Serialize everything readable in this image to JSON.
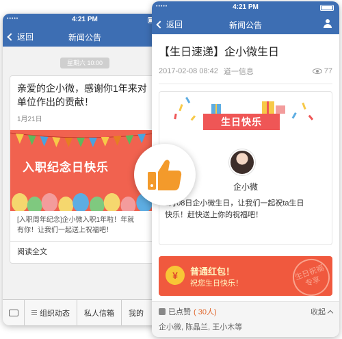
{
  "status_bar": {
    "carrier": "•••••",
    "time": "4:21 PM"
  },
  "left_screen": {
    "nav": {
      "back_label": "返回",
      "title": "新闻公告"
    },
    "timestamp": "星期六 10:00",
    "message": {
      "title": "亲爱的企小微，感谢你1年来对\n单位作出的贡献！",
      "date": "1月21日",
      "banner_text": "入职纪念日快乐",
      "summary": "[入职周年纪念]企小微入职1年啦！年就\n有你！让我们一起送上祝福吧！",
      "read_more": "阅读全文"
    },
    "bottom_tabs": [
      {
        "label": "组织动态"
      },
      {
        "label": "私人信箱"
      },
      {
        "label": "我的"
      }
    ]
  },
  "right_screen": {
    "nav": {
      "back_label": "返回",
      "title": "新闻公告"
    },
    "article": {
      "title": "【生日速递】企小微生日",
      "date": "2017-02-08 08:42",
      "source": "道一信息",
      "views": "77"
    },
    "birthday_card": {
      "ribbon_text": "生日快乐",
      "name": "企小微",
      "text": "2月08日企小微生日，让我们一起祝ta生日\n快乐！赶快送上你的祝福吧！"
    },
    "red_packet": {
      "coin_symbol": "¥",
      "title": "普通红包！",
      "subtitle": "祝您生日快乐！",
      "stamp_text": "生日祝福\n专享"
    },
    "likes": {
      "label": "已点赞",
      "count_text": "( 30人)",
      "collapse_label": "收起",
      "likers": "企小微, 陈晶兰, 王小木等"
    }
  },
  "colors": {
    "nav_blue": "#3d6eb3",
    "banner_red": "#f1624f",
    "thumb_orange": "#f39a2b"
  }
}
